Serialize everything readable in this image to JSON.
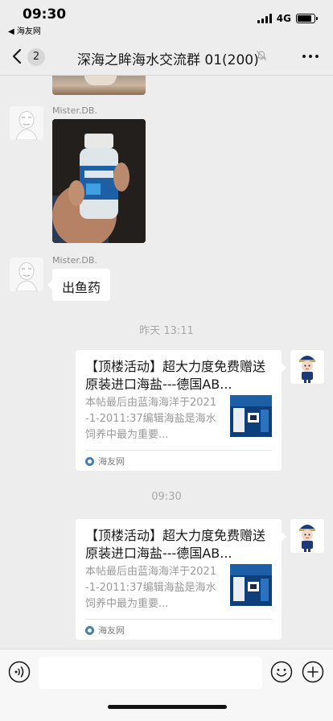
{
  "status_bar": {
    "time": "09:30",
    "back_app": "◀ 海友网",
    "network": "4G"
  },
  "nav": {
    "unread_count": "2",
    "title": "深海之眸海水交流群 01(200)",
    "icons": {
      "back": "chevron-left-icon",
      "mute": "mute-bell-icon",
      "more": "more-dots-icon"
    }
  },
  "messages": [
    {
      "type": "image",
      "sender": "Mister.DB.",
      "image_description": "hand holding medicine bottle"
    },
    {
      "type": "text",
      "sender": "Mister.DB.",
      "text": "出鱼药"
    },
    {
      "type": "time",
      "text": "昨天 13:11"
    },
    {
      "type": "link",
      "title": "【顶楼活动】超大力度免费赠送原装进口海盐---德国AB...",
      "description": "本帖最后由蓝海海洋于2021-1-2011:37编辑海盐是海水饲养中最为重要...",
      "source": "海友网"
    },
    {
      "type": "time",
      "text": "09:30"
    },
    {
      "type": "link",
      "title": "【顶楼活动】超大力度免费赠送原装进口海盐---德国AB...",
      "description": "本帖最后由蓝海海洋于2021-1-2011:37编辑海盐是海水饲养中最为重要...",
      "source": "海友网"
    }
  ],
  "input_bar": {
    "placeholder": "",
    "icons": {
      "voice": "voice-icon",
      "emoji": "emoji-icon",
      "plus": "plus-icon"
    }
  },
  "colors": {
    "background": "#ededed",
    "bubble": "#ffffff",
    "timestamp": "#a8a8a8",
    "source_icon": "#4a7fa8"
  }
}
